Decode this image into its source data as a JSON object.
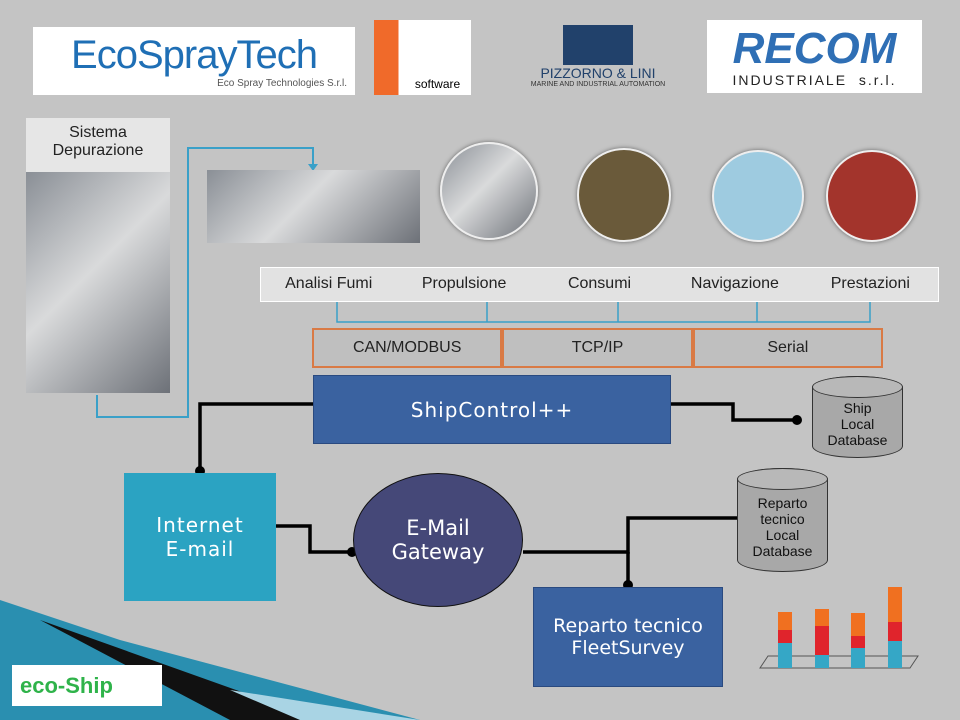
{
  "logos": {
    "ecospray": {
      "main": "EcoSprayTech",
      "sub": "Eco Spray Technologies S.r.l."
    },
    "be": {
      "sub": "software"
    },
    "pizzorno": {
      "main": "PIZZORNO & LINI",
      "sub": "MARINE AND INDUSTRIAL AUTOMATION"
    },
    "recom": {
      "main": "RECOM",
      "sub": "INDUSTRIALE  s.r.l."
    },
    "ecoship": {
      "main": "eco-Ship"
    }
  },
  "sistema": {
    "label": "Sistema\nDepurazione"
  },
  "categories": [
    "Analisi  Fumi",
    "Propulsione",
    "Consumi",
    "Navigazione",
    "Prestazioni"
  ],
  "protocols": [
    "CAN/MODBUS",
    "TCP/IP",
    "Serial"
  ],
  "nodes": {
    "shipcontrol": "ShipControl++",
    "ship_db": "Ship\nLocal\nDatabase",
    "internet": "Internet\nE-mail",
    "gateway": "E-Mail\nGateway",
    "reparto_db": "Reparto\ntecnico\nLocal\nDatabase",
    "fleetsurvey": "Reparto tecnico\nFleetSurvey"
  },
  "colors": {
    "shipcontrol": "#3a62a0",
    "internet": "#2ba3c2",
    "gateway": "#454878",
    "fleetsurvey": "#3a62a0",
    "protocol_border": "#d97a45"
  }
}
